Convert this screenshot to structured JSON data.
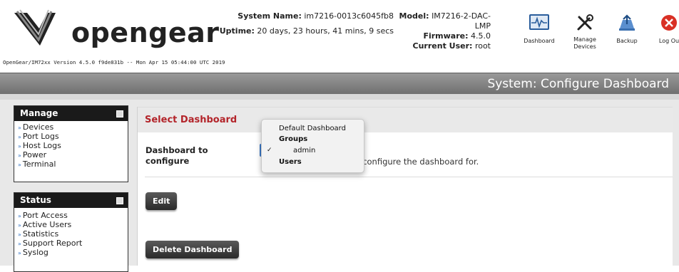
{
  "header": {
    "logo_text": "opengear",
    "version_line": "OpenGear/IM72xx Version 4.5.0 f9de831b -- Mon Apr 15 05:44:00 UTC 2019",
    "system_name_label": "System Name:",
    "system_name_value": "im7216-0013c6045fb8",
    "model_label": "Model:",
    "model_value": "IM7216-2-DAC-LMP",
    "firmware_label": "Firmware:",
    "firmware_value": "4.5.0",
    "uptime_label": "Uptime:",
    "uptime_value": "20 days, 23 hours, 41 mins, 9 secs",
    "current_user_label": "Current User:",
    "current_user_value": "root",
    "toolbar": {
      "dashboard": "Dashboard",
      "manage_devices_1": "Manage",
      "manage_devices_2": "Devices",
      "backup": "Backup",
      "logout": "Log Ou"
    }
  },
  "title": "System: Configure Dashboard",
  "sidebar": {
    "manage": {
      "heading": "Manage",
      "items": [
        "Devices",
        "Port Logs",
        "Host Logs",
        "Power",
        "Terminal"
      ]
    },
    "status": {
      "heading": "Status",
      "items": [
        "Port Access",
        "Active Users",
        "Statistics",
        "Support Report",
        "Syslog"
      ]
    }
  },
  "main": {
    "section_title": "Select Dashboard",
    "field_label_1": "Dashboard to",
    "field_label_2": "configure",
    "field_hint": "to configure the dashboard for.",
    "edit_button": "Edit",
    "delete_button": "Delete Dashboard"
  },
  "dropdown": {
    "default_option": "Default Dashboard",
    "group_groups": "Groups",
    "selected_option": "admin",
    "check_mark": "✓",
    "group_users": "Users"
  },
  "colors": {
    "accent_red": "#b3242a",
    "link_blue": "#3a78c8",
    "sidebar_head": "#1a1a1a"
  }
}
